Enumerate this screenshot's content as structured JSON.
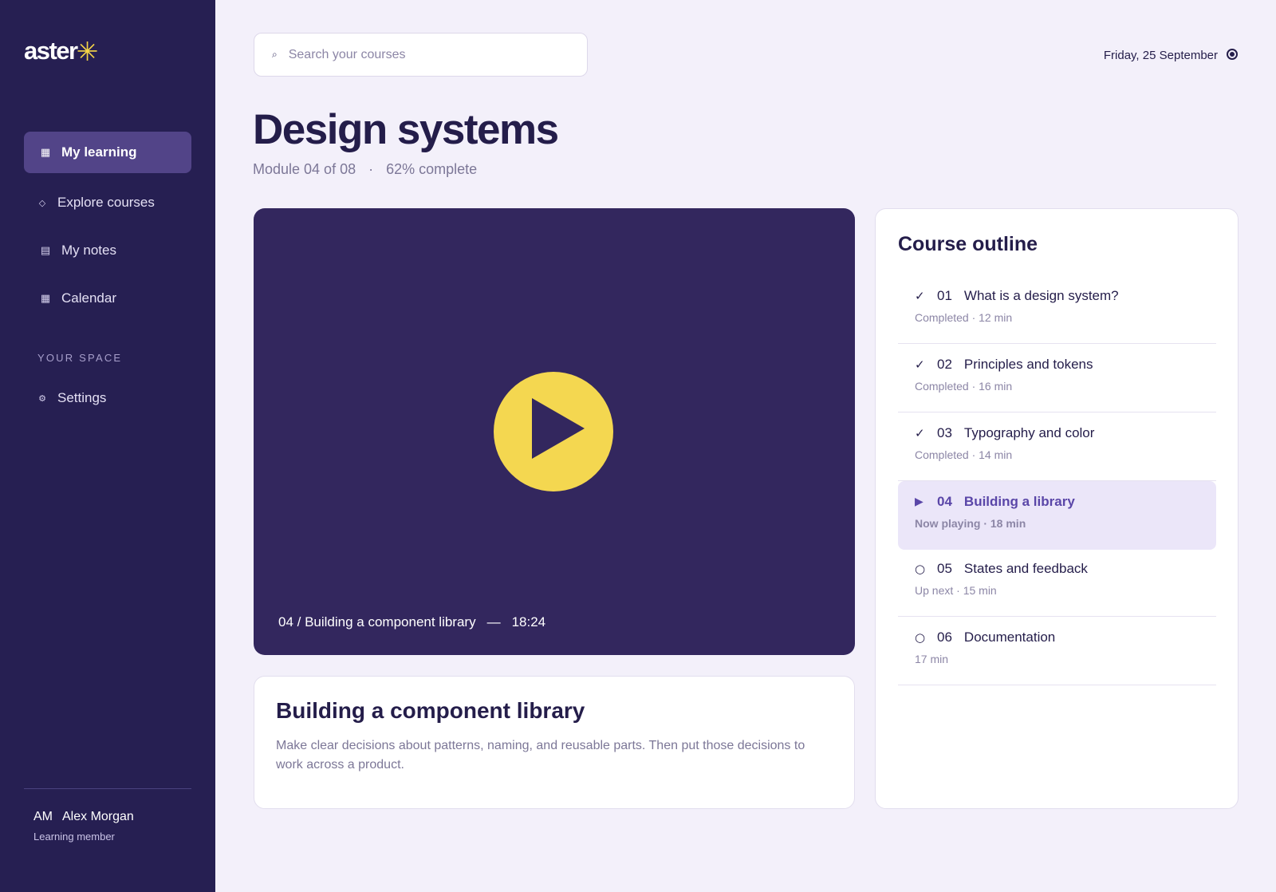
{
  "app": {
    "logo_text": "aster",
    "logo_mark": "✳"
  },
  "sidebar": {
    "items": [
      {
        "label": "My learning",
        "icon": "grid-icon",
        "glyph": "▦",
        "active": true
      },
      {
        "label": "Explore courses",
        "icon": "diamond-icon",
        "glyph": "◇",
        "active": false
      },
      {
        "label": "My notes",
        "icon": "notes-icon",
        "glyph": "▤",
        "active": false
      },
      {
        "label": "Calendar",
        "icon": "calendar-icon",
        "glyph": "▦",
        "active": false
      }
    ],
    "section_label": "YOUR SPACE",
    "settings": {
      "label": "Settings",
      "icon": "gear-icon",
      "glyph": "⚙"
    },
    "user": {
      "initials": "AM",
      "name": "Alex Morgan",
      "role": "Learning member"
    }
  },
  "header": {
    "search": {
      "placeholder": "Search your courses",
      "value": "",
      "icon_glyph": "⌕"
    },
    "date": "Friday, 25 September"
  },
  "course": {
    "title": "Design systems",
    "module": "Module 04 of 08",
    "separator": "·",
    "progress_text": "62% complete",
    "progress": 0.62
  },
  "video": {
    "caption": "04 / Building a component library",
    "dash": "—",
    "duration": "18:24",
    "background": "#33275e",
    "play_color": "#f4d750"
  },
  "lesson": {
    "title": "Building a component library",
    "description": "Make clear decisions about patterns, naming, and reusable parts. Then put those decisions to work across a product."
  },
  "outline": {
    "title": "Course outline",
    "items": [
      {
        "mark": "✓",
        "number": "01",
        "title": "What is a design system?",
        "meta": "Completed · 12 min",
        "state": "completed"
      },
      {
        "mark": "✓",
        "number": "02",
        "title": "Principles and tokens",
        "meta": "Completed · 16 min",
        "state": "completed"
      },
      {
        "mark": "✓",
        "number": "03",
        "title": "Typography and color",
        "meta": "Completed · 14 min",
        "state": "completed"
      },
      {
        "mark": "▶",
        "number": "04",
        "title": "Building a library",
        "meta": "Now playing · 18 min",
        "state": "playing"
      },
      {
        "mark": "○",
        "number": "05",
        "title": "States and feedback",
        "meta": "Up next · 15 min",
        "state": "upcoming"
      },
      {
        "mark": "○",
        "number": "06",
        "title": "Documentation",
        "meta": "17 min",
        "state": "upcoming"
      }
    ]
  },
  "colors": {
    "sidebar_bg": "#261f52",
    "active_nav": "#524488",
    "accent": "#f4d750",
    "page_bg": "#f3f0fa",
    "text": "#241d4a",
    "highlight": "#ebe6f9"
  }
}
